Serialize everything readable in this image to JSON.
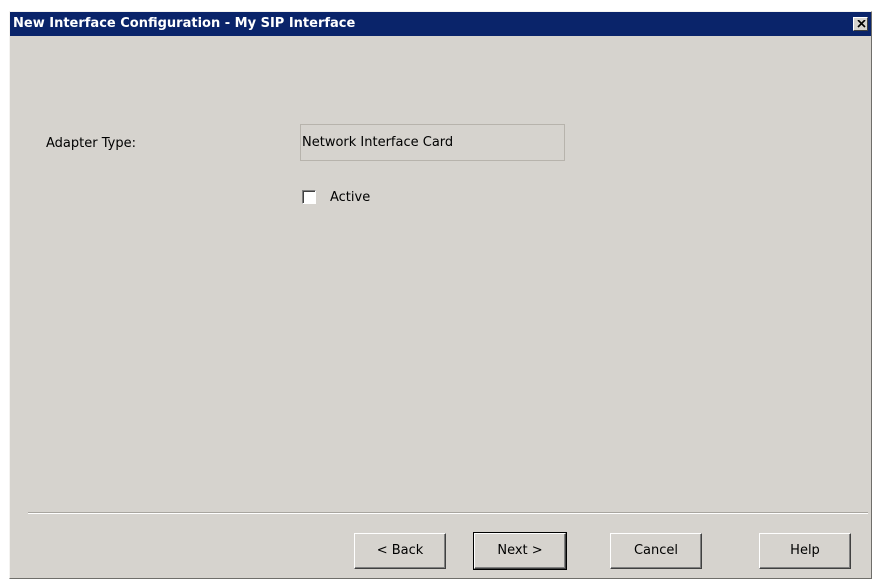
{
  "window": {
    "title": "New Interface Configuration - My SIP Interface"
  },
  "form": {
    "adapter_type_label": "Adapter Type:",
    "adapter_type_value": "Network Interface Card",
    "active_label": "Active",
    "active_checked": false
  },
  "buttons": {
    "back": "< Back",
    "next": "Next >",
    "cancel": "Cancel",
    "help": "Help"
  },
  "colors": {
    "titlebar": "#0a246a",
    "dialog_face": "#d6d3ce"
  }
}
